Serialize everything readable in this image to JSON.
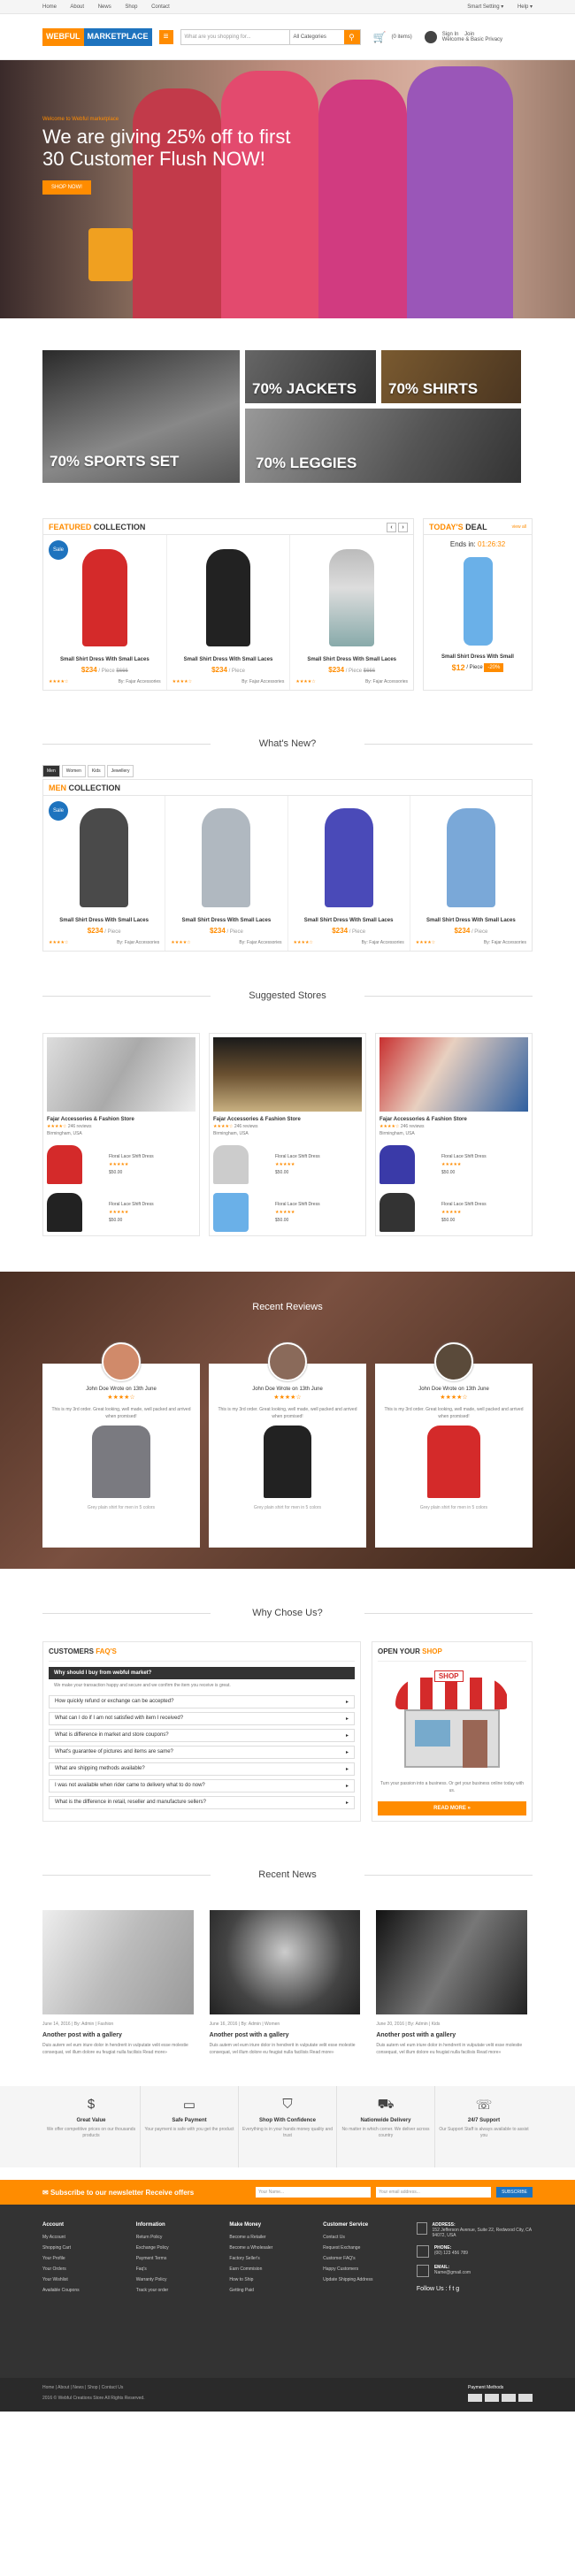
{
  "topbar": {
    "links": [
      "Home",
      "About",
      "News",
      "Shop",
      "Contact"
    ],
    "right": [
      "Smart Setting ▾",
      "Help ▾"
    ]
  },
  "header": {
    "logo_a": "WEBFUL",
    "logo_b": "MARKETPLACE",
    "search_placeholder": "What are you shopping for...",
    "category": "All Categories",
    "cart": "(0 items)",
    "signin": "Sign In",
    "join": "Join",
    "welcome": "Welcome & Basic Privacy"
  },
  "hero": {
    "small": "Welcome to Webful marketplace",
    "headline": "We are giving 25% off to first 30 Customer Flush NOW!",
    "button": "SHOP NOW!"
  },
  "banners": [
    "70% SPORTS SET",
    "70% JACKETS",
    "70% SHIRTS",
    "70% LEGGIES"
  ],
  "featured": {
    "title_a": "FEATURED",
    "title_b": "COLLECTION",
    "products": [
      {
        "name": "Small Shirt Dress With Small Laces",
        "price": "$234",
        "unit": "/ Piece",
        "old": "$666",
        "sale": "Sale",
        "seller": "By: Fajar Accessories"
      },
      {
        "name": "Small Shirt Dress With Small Laces",
        "price": "$234",
        "unit": "/ Piece",
        "old": "",
        "seller": "By: Fajar Accessories"
      },
      {
        "name": "Small Shirt Dress With Small Laces",
        "price": "$234",
        "unit": "/ Piece",
        "old": "$666",
        "seller": "By: Fajar Accessories"
      }
    ]
  },
  "deal": {
    "title_a": "TODAY'S",
    "title_b": "DEAL",
    "view": "view all",
    "ends": "Ends in:",
    "timer": "01:26:32",
    "name": "Small Shirt Dress With Small",
    "price": "$12",
    "unit": "/ Piece",
    "off": "-20%"
  },
  "whats_new": "What's New?",
  "tabs": [
    "Men",
    "Women",
    "Kids",
    "Jewellery"
  ],
  "men": {
    "title_a": "MEN",
    "title_b": "COLLECTION",
    "products": [
      {
        "name": "Small Shirt Dress With Small Laces",
        "price": "$234",
        "unit": "/ Piece",
        "seller": "By: Fajar Accessories",
        "sale": "Sale"
      },
      {
        "name": "Small Shirt Dress With Small Laces",
        "price": "$234",
        "unit": "/ Piece",
        "seller": "By: Fajar Accessories"
      },
      {
        "name": "Small Shirt Dress With Small Laces",
        "price": "$234",
        "unit": "/ Piece",
        "seller": "By: Fajar Accessories"
      },
      {
        "name": "Small Shirt Dress With Small Laces",
        "price": "$234",
        "unit": "/ Piece",
        "seller": "By: Fajar Accessories"
      }
    ]
  },
  "stores_title": "Suggested Stores",
  "stores": [
    {
      "name": "Fajar Accessories & Fashion Store",
      "reviews": "246 reviews",
      "location": "Birmingham, USA",
      "items": [
        {
          "name": "Floral Lace Shift Dress",
          "price": "$50.00"
        },
        {
          "name": "Floral Lace Shift Dress",
          "price": "$50.00"
        }
      ]
    },
    {
      "name": "Fajar Accessories & Fashion Store",
      "reviews": "246 reviews",
      "location": "Birmingham, USA",
      "items": [
        {
          "name": "Floral Lace Shift Dress",
          "price": "$50.00"
        },
        {
          "name": "Floral Lace Shift Dress",
          "price": "$50.00"
        }
      ]
    },
    {
      "name": "Fajar Accessories & Fashion Store",
      "reviews": "246 reviews",
      "location": "Birmingham, USA",
      "items": [
        {
          "name": "Floral Lace Shift Dress",
          "price": "$50.00"
        },
        {
          "name": "Floral Lace Shift Dress",
          "price": "$50.00"
        }
      ]
    }
  ],
  "reviews_title": "Recent Reviews",
  "reviews": [
    {
      "who": "John Doe Wrote on 13th June",
      "text": "This is my 3rd order. Great looking, well made, well packed and arrived when promised!",
      "cap": "Grey plain shirt for men in 5 colors"
    },
    {
      "who": "John Doe Wrote on 13th June",
      "text": "This is my 3rd order. Great looking, well made, well packed and arrived when promised!",
      "cap": "Grey plain shirt for men in 5 colors"
    },
    {
      "who": "John Doe Wrote on 13th June",
      "text": "This is my 3rd order. Great looking, well made, well packed and arrived when promised!",
      "cap": "Grey plain shirt for men in 5 colors"
    }
  ],
  "why_title": "Why Chose Us?",
  "faq": {
    "title_a": "CUSTOMERS",
    "title_b": "FAQ'S",
    "open_q": "Why should I buy from webful market?",
    "open_a": "We make your transaction happy and secure and we confirm the item you receive is great.",
    "questions": [
      "How quickly refund or exchange can be accepted?",
      "What can I do if I am not satisfied with item I received?",
      "What is difference in market and store coupons?",
      "What's guarantee of pictures and items are same?",
      "What are shipping methods available?",
      "I was not available when rider came to delivery what to do now?",
      "What is the difference in retail, reseller and manufacture sellers?"
    ]
  },
  "openshop": {
    "title_a": "OPEN YOUR",
    "title_b": "SHOP",
    "sign": "SHOP",
    "text": "Turn your passion into a business. Or get your business online today with us.",
    "button": "READ MORE »"
  },
  "news_title": "Recent News",
  "news": [
    {
      "date": "June 14, 2016 | By: Admin | Fashion",
      "title": "Another post with a gallery",
      "text": "Duis autem vel eum iriure dolor in hendrerit in vulputate velit esse molestie consequat, vel illum dolore eu feugiat nulla facilisis Read more»"
    },
    {
      "date": "June 16, 2016 | By: Admin | Women",
      "title": "Another post with a gallery",
      "text": "Duis autem vel eum iriure dolor in hendrerit in vulputate velit esse molestie consequat, vel illum dolore eu feugiat nulla facilisis Read more»"
    },
    {
      "date": "June 20, 2016 | By: Admin | Kids",
      "title": "Another post with a gallery",
      "text": "Duis autem vel eum iriure dolor in hendrerit in vulputate velit esse molestie consequat, vel illum dolore eu feugiat nulla facilisis Read more»"
    }
  ],
  "features": [
    {
      "icon": "money-icon",
      "title": "Great Value",
      "text": "We offer competitive prices on our thousands products"
    },
    {
      "icon": "card-icon",
      "title": "Safe Payment",
      "text": "Your payment is safe with you get the product"
    },
    {
      "icon": "shield-icon",
      "title": "Shop With Confidence",
      "text": "Everything is in your hands money quality and trust"
    },
    {
      "icon": "truck-icon",
      "title": "Nationwide Delivery",
      "text": "No matter in which corner. We deliver across country"
    },
    {
      "icon": "support-icon",
      "title": "24/7 Support",
      "text": "Our Support Staff is always available to assist you"
    }
  ],
  "newsletter": {
    "text": "Subscribe to our newsletter Receive offers",
    "name": "Your Name...",
    "email": "Your email address...",
    "button": "SUBSCRIBE"
  },
  "footer": {
    "cols": [
      {
        "title": "Account",
        "items": [
          "My Account",
          "Shopping Cart",
          "Your Profile",
          "Your Orders",
          "Your Wishlist",
          "Available Coupons"
        ]
      },
      {
        "title": "Information",
        "items": [
          "Return Policy",
          "Exchange Policy",
          "Payment Terms",
          "Faq's",
          "Warranty Policy",
          "Track your order"
        ]
      },
      {
        "title": "Make Money",
        "items": [
          "Become a Retailer",
          "Become a Wholesaler",
          "Factory Seller's",
          "Earn Commision",
          "How to Ship",
          "Getting Paid"
        ]
      },
      {
        "title": "Customer Service",
        "items": [
          "Contact Us",
          "Request Exchange",
          "Customer FAQ's",
          "Happy Customers",
          "Update Shipping Address"
        ]
      }
    ],
    "address_h": "ADDRESS:",
    "address": "152 Jefferson Avenue, Suite 22, Redwood City, CA 94072, USA",
    "phone_h": "PHONE:",
    "phone": "(00) 123 456 789",
    "email_h": "EMAIL:",
    "email": "Name@gmail.com",
    "follow": "Follow Us :"
  },
  "bottom": {
    "links": "Home | About | News | Shop | Contact Us",
    "copy": "2016 © Webful Creations Store All Rights Reserved.",
    "pay": "Payment Methods"
  },
  "colors": {
    "accent": "#ff8c00",
    "brand": "#1e73be"
  }
}
